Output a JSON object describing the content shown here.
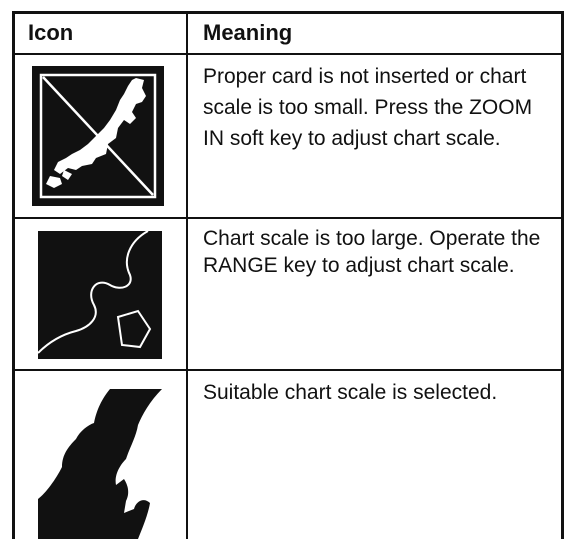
{
  "table": {
    "header": {
      "icon": "Icon",
      "meaning": "Meaning"
    },
    "rows": [
      {
        "icon": "no-chart-card-icon",
        "meaning": "Proper card is not inserted or chart scale is too small. Press the ZOOM IN soft key to adjust chart scale."
      },
      {
        "icon": "chart-scale-too-large-icon",
        "meaning": "Chart scale is too large. Operate the RANGE key to adjust chart scale."
      },
      {
        "icon": "suitable-chart-scale-icon",
        "meaning": "Suitable chart scale is selected."
      }
    ]
  },
  "colors": {
    "ink": "#111111",
    "background": "#ffffff"
  }
}
